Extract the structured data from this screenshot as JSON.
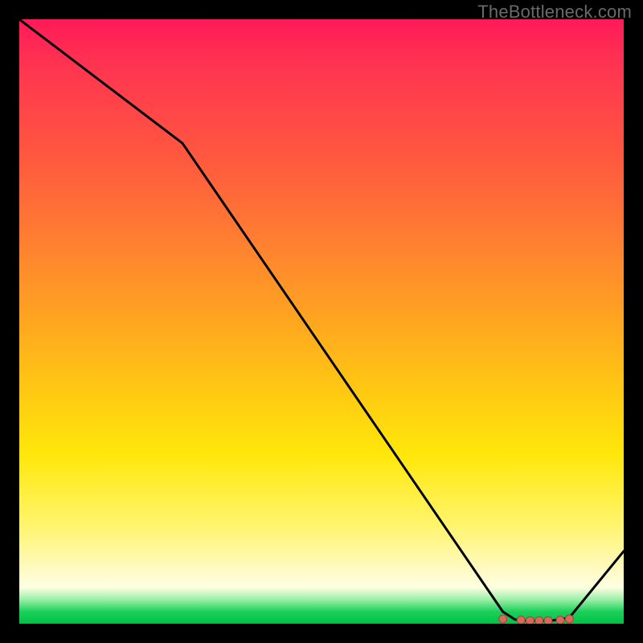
{
  "attribution": "TheBottleneck.com",
  "chart_data": {
    "type": "line",
    "title": "",
    "xlabel": "",
    "ylabel": "",
    "xlim": [
      0,
      100
    ],
    "ylim": [
      0,
      100
    ],
    "series": [
      {
        "name": "curve",
        "x": [
          0,
          27,
          80,
          82,
          84,
          86,
          88,
          91,
          100
        ],
        "values": [
          100,
          79.5,
          2,
          0.7,
          0.5,
          0.5,
          0.5,
          1,
          12
        ]
      }
    ],
    "markers": {
      "name": "curve-dots",
      "x": [
        80,
        83,
        84.5,
        86,
        87.5,
        89.5,
        91
      ],
      "values": [
        0.8,
        0.6,
        0.5,
        0.5,
        0.5,
        0.6,
        0.8
      ]
    },
    "colors": {
      "line": "#000000",
      "marker": "#d86a5c",
      "gradient_top": "#ff1a58",
      "gradient_bottom": "#00c247"
    }
  }
}
